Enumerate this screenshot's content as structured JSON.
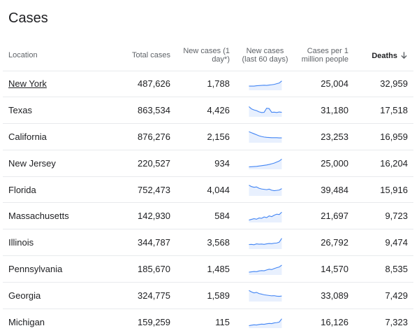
{
  "title": "Cases",
  "columns": {
    "location": "Location",
    "total": "Total cases",
    "new": "New cases (1 day*)",
    "spark": "New cases (last 60 days)",
    "per_million": "Cases per 1 million people",
    "deaths": "Deaths"
  },
  "sort": {
    "column": "deaths",
    "direction": "descending",
    "icon": "arrow-down-icon"
  },
  "accent_color": "#4285f4",
  "rows": [
    {
      "location": "New York",
      "total": "487,626",
      "new": "1,788",
      "per_million": "25,004",
      "deaths": "32,959",
      "linked": true,
      "trend": [
        2,
        2,
        2,
        2.2,
        2.3,
        2.4,
        2.5,
        2.4,
        2.6,
        2.8,
        3,
        3.4,
        3.8,
        5
      ]
    },
    {
      "location": "Texas",
      "total": "863,534",
      "new": "4,426",
      "per_million": "31,180",
      "deaths": "17,518",
      "linked": false,
      "trend": [
        5.5,
        4.2,
        3.6,
        3.2,
        2.5,
        2.1,
        2.2,
        4.6,
        4.4,
        2.2,
        2.3,
        2.1,
        2.4,
        2.2
      ]
    },
    {
      "location": "California",
      "total": "876,276",
      "new": "2,156",
      "per_million": "23,253",
      "deaths": "16,959",
      "linked": false,
      "trend": [
        6,
        5.4,
        4.8,
        4.2,
        3.6,
        3.2,
        2.9,
        2.7,
        2.6,
        2.5,
        2.5,
        2.5,
        2.4,
        2.4
      ]
    },
    {
      "location": "New Jersey",
      "total": "220,527",
      "new": "934",
      "per_million": "25,000",
      "deaths": "16,204",
      "linked": false,
      "trend": [
        1,
        1.1,
        1.2,
        1.3,
        1.5,
        1.7,
        1.9,
        2.1,
        2.4,
        2.8,
        3.2,
        3.8,
        4.4,
        5.5
      ]
    },
    {
      "location": "Florida",
      "total": "752,473",
      "new": "4,044",
      "per_million": "39,484",
      "deaths": "15,916",
      "linked": false,
      "trend": [
        5.8,
        5,
        4.6,
        4.8,
        4,
        3.6,
        3.4,
        3.2,
        3.5,
        2.9,
        2.6,
        2.8,
        3,
        3.8
      ]
    },
    {
      "location": "Massachusetts",
      "total": "142,930",
      "new": "584",
      "per_million": "21,697",
      "deaths": "9,723",
      "linked": false,
      "trend": [
        1,
        1.4,
        1.8,
        1.5,
        2.2,
        2,
        2.8,
        2.4,
        3.4,
        3,
        3.8,
        4.4,
        4.2,
        5.6
      ]
    },
    {
      "location": "Illinois",
      "total": "344,787",
      "new": "3,568",
      "per_million": "26,792",
      "deaths": "9,474",
      "linked": false,
      "trend": [
        2.2,
        2.3,
        2.1,
        2.6,
        2.4,
        2.5,
        2.3,
        2.6,
        2.8,
        2.7,
        3,
        3.1,
        3.6,
        5.8
      ]
    },
    {
      "location": "Pennsylvania",
      "total": "185,670",
      "new": "1,485",
      "per_million": "14,570",
      "deaths": "8,535",
      "linked": false,
      "trend": [
        1.2,
        1.4,
        1.6,
        1.5,
        1.9,
        2.1,
        2,
        2.5,
        2.9,
        2.7,
        3.3,
        3.8,
        4.2,
        5.3
      ]
    },
    {
      "location": "Georgia",
      "total": "324,775",
      "new": "1,589",
      "per_million": "33,089",
      "deaths": "7,429",
      "linked": false,
      "trend": [
        6,
        5.2,
        4.6,
        4.9,
        4.2,
        3.9,
        3.5,
        3.3,
        3.1,
        2.9,
        3,
        2.7,
        2.6,
        2.8
      ]
    },
    {
      "location": "Michigan",
      "total": "159,259",
      "new": "115",
      "per_million": "16,126",
      "deaths": "7,323",
      "linked": false,
      "trend": [
        1,
        1.3,
        1.5,
        1.4,
        1.7,
        1.9,
        1.8,
        2.1,
        2.3,
        2.2,
        2.6,
        2.8,
        3.1,
        5
      ]
    }
  ]
}
